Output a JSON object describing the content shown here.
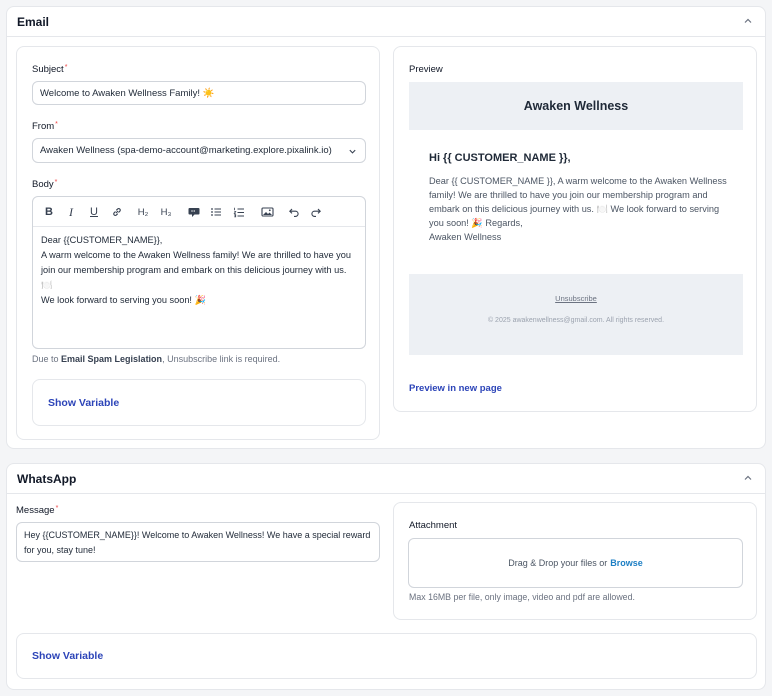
{
  "email": {
    "section_title": "Email",
    "subject_label": "Subject",
    "subject_value": "Welcome to Awaken Wellness Family! ☀️",
    "from_label": "From",
    "from_value": "Awaken Wellness (spa-demo-account@marketing.explore.pixalink.io)",
    "body_label": "Body",
    "toolbar": {
      "bold": "B",
      "italic": "I",
      "underline": "U",
      "link": "link-icon",
      "h2": "H₂",
      "h3": "H₃",
      "quote": "quote-icon",
      "bullet_list": "bullet-list-icon",
      "ordered_list": "ordered-list-icon",
      "image": "image-icon",
      "undo": "undo-icon",
      "redo": "redo-icon"
    },
    "body_lines": [
      "Dear {{CUSTOMER_NAME}},",
      "A warm welcome to the Awaken Wellness family! We are thrilled to have you join our membership program and embark on this delicious journey with us. 🍽️",
      " We look forward to serving you soon! 🎉"
    ],
    "spam_note_prefix": "Due to ",
    "spam_note_bold": "Email Spam Legislation",
    "spam_note_suffix": ", Unsubscribe link is required.",
    "show_variable": "Show Variable",
    "preview": {
      "label": "Preview",
      "brand": "Awaken Wellness",
      "greeting": "Hi {{ CUSTOMER_NAME }},",
      "body": "Dear {{ CUSTOMER_NAME }}, A warm welcome to the Awaken Wellness family! We are thrilled to have you join our membership program and embark on this delicious journey with us. 🍽️ We look forward to serving you soon! 🎉  Regards,",
      "signature": "Awaken Wellness",
      "unsubscribe": "Unsubscribe",
      "copyright": "© 2025 awakenwellness@gmail.com. All rights reserved.",
      "open_new_page": "Preview in new page"
    }
  },
  "whatsapp": {
    "section_title": "WhatsApp",
    "message_label": "Message",
    "message_value": "Hey {{CUSTOMER_NAME}}! Welcome to Awaken Wellness! We have a special reward for you, stay tune!",
    "attachment_label": "Attachment",
    "drop_text": "Drag & Drop your files or ",
    "browse": "Browse",
    "attachment_note": "Max 16MB per file, only image, video and pdf are allowed.",
    "show_variable": "Show Variable"
  },
  "colors": {
    "accent": "#2c44b8",
    "browse": "#1d7fc4",
    "required": "#ef4444",
    "preview_bg": "#edf0f4"
  }
}
